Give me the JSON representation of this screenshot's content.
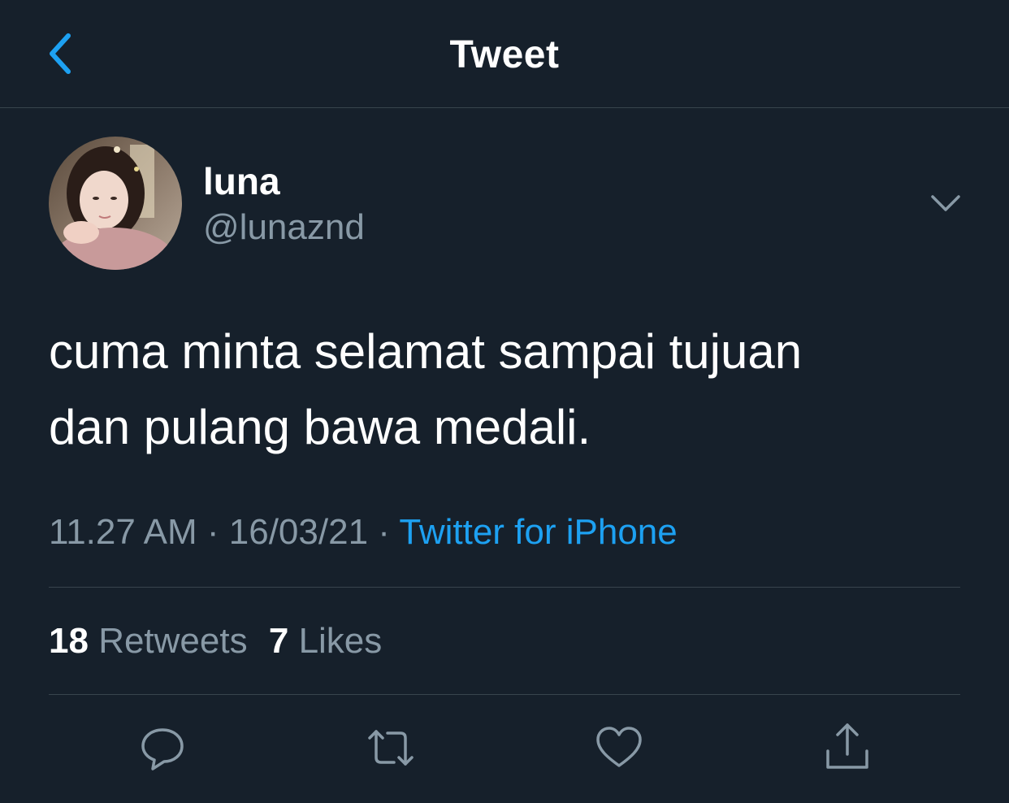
{
  "header": {
    "title": "Tweet",
    "back_icon": "chevron-left-icon"
  },
  "author": {
    "name": "luna",
    "handle": "@lunaznd"
  },
  "tweet": {
    "text": "cuma minta selamat sampai tujuan\ndan pulang bawa medali.",
    "time": "11.27 AM",
    "date": "16/03/21",
    "separator": "·",
    "source": "Twitter for iPhone"
  },
  "stats": {
    "retweets_count": "18",
    "retweets_label": "Retweets",
    "likes_count": "7",
    "likes_label": "Likes"
  },
  "actions": [
    "reply-icon",
    "retweet-icon",
    "like-icon",
    "share-icon"
  ],
  "colors": {
    "background": "#16202b",
    "accent": "#1da1f2",
    "secondary_text": "#8899a6",
    "divider": "#38444d"
  }
}
